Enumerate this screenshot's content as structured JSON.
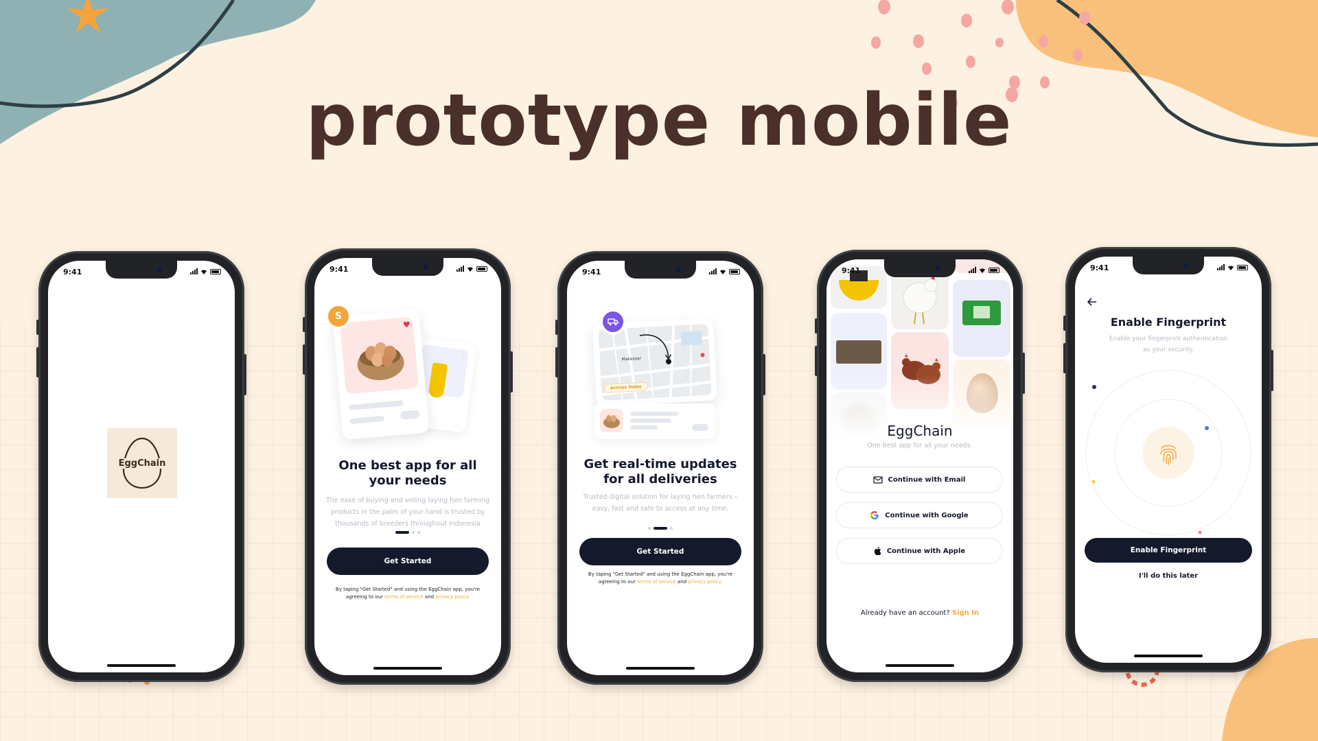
{
  "title": "prototype mobile",
  "status_time": "9:41",
  "screens": {
    "splash": {
      "logo_text": "EggChain"
    },
    "onboard1": {
      "badge": "S",
      "heading_line1": "One best app for all",
      "heading_line2": "your needs",
      "body": "The ease of buying and selling laying hen farming products in the palm of your hand is trusted by thousands of breeders throughout Indonesia",
      "button": "Get Started",
      "terms_prefix": "By taping \"Get Started\" and using the EggChain app, you're agreeing to our",
      "terms_link": "terms of service",
      "terms_and": "and",
      "privacy_link": "privacy policy."
    },
    "onboard2": {
      "map_chip": "Arrives Today",
      "map_label": "Makassar",
      "heading_line1": "Get real-time updates",
      "heading_line2": "for all deliveries",
      "body": "Trusted digital solution for laying hen farmers – easy, fast and safe to access at any time.",
      "button": "Get Started",
      "terms_prefix": "By taping \"Get Started\" and using the EggChain app, you're agreeing to our",
      "terms_link": "terms of service",
      "terms_and": "and",
      "privacy_link": "privacy policy."
    },
    "login": {
      "brand": "EggChain",
      "tagline": "One best app for all your needs.",
      "email_button": "Continue with Email",
      "google_button": "Continue with Google",
      "apple_button": "Continue with Apple",
      "account_prompt": "Already have an account?",
      "sign_in_link": "Sign In"
    },
    "fingerprint": {
      "heading": "Enable Fingerprint",
      "body_line1": "Enable your fingerprint authentication",
      "body_line2": "as your security.",
      "enable_button": "Enable Fingerprint",
      "later_link": "I'll do this later"
    }
  },
  "colors": {
    "background": "#fdf1e1",
    "title": "#4a2f2b",
    "button_dark": "#141a2c",
    "accent_orange": "#f2a93b",
    "teal_blob": "#8fb1b3",
    "orange_blob": "#f8c07a"
  }
}
